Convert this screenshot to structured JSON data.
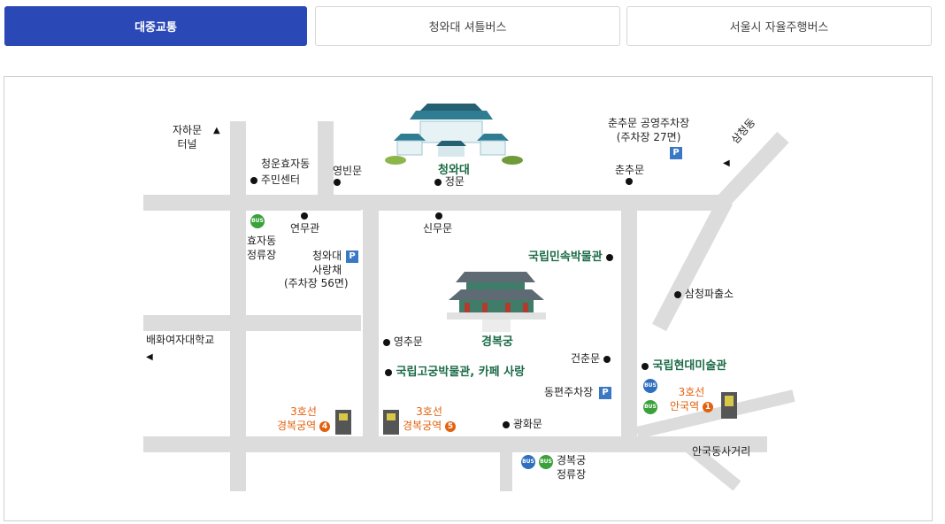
{
  "tabs": [
    {
      "label": "대중교통",
      "active": true
    },
    {
      "label": "청와대 셔틀버스",
      "active": false
    },
    {
      "label": "서울시 자율주행버스",
      "active": false
    }
  ],
  "map": {
    "jahamun": {
      "line1": "자하문",
      "line2": "터널"
    },
    "cheongun": {
      "line1": "청운효자동",
      "line2": "주민센터"
    },
    "yeongbinmun": "영빈문",
    "cheongwadae": "청와대",
    "jeongmun": "정문",
    "chunchu_parking": {
      "line1": "춘추문 공영주차장",
      "line2": "(주차장 27면)",
      "badge": "P"
    },
    "chunchumun": "춘추문",
    "samcheongdong": "삼청동",
    "bus_label": "BUS",
    "hyoja_stop": {
      "line1": "효자동",
      "line2": "정류장"
    },
    "yeonmugwan": "연무관",
    "sinmumun": "신무문",
    "sarangchae": {
      "line1": "청와대",
      "line2": "사랑채",
      "line3": "(주차장 56면)",
      "badge": "P"
    },
    "folk_museum": "국립민속박물관",
    "samcheong_police": "삼청파출소",
    "ewha": "배화여자대학교",
    "yeongchumun": "영추문",
    "gyeongbokgung": "경복궁",
    "geonchunmun": "건춘문",
    "mmca": "국립현대미술관",
    "palace_museum": "국립고궁박물관, 카페 사랑",
    "dongpyeon_parking": {
      "label": "동편주차장",
      "badge": "P"
    },
    "anguk": {
      "line1": "3호선",
      "line2": "안국역",
      "exit": "1"
    },
    "gbg_station_4": {
      "line1": "3호선",
      "line2": "경복궁역",
      "exit": "4"
    },
    "gbg_station_5": {
      "line1": "3호선",
      "line2": "경복궁역",
      "exit": "5"
    },
    "gwanghwamun": "광화문",
    "gbg_stop": {
      "line1": "경복궁",
      "line2": "정류장"
    },
    "anguk_intersection": "안국동사거리"
  }
}
